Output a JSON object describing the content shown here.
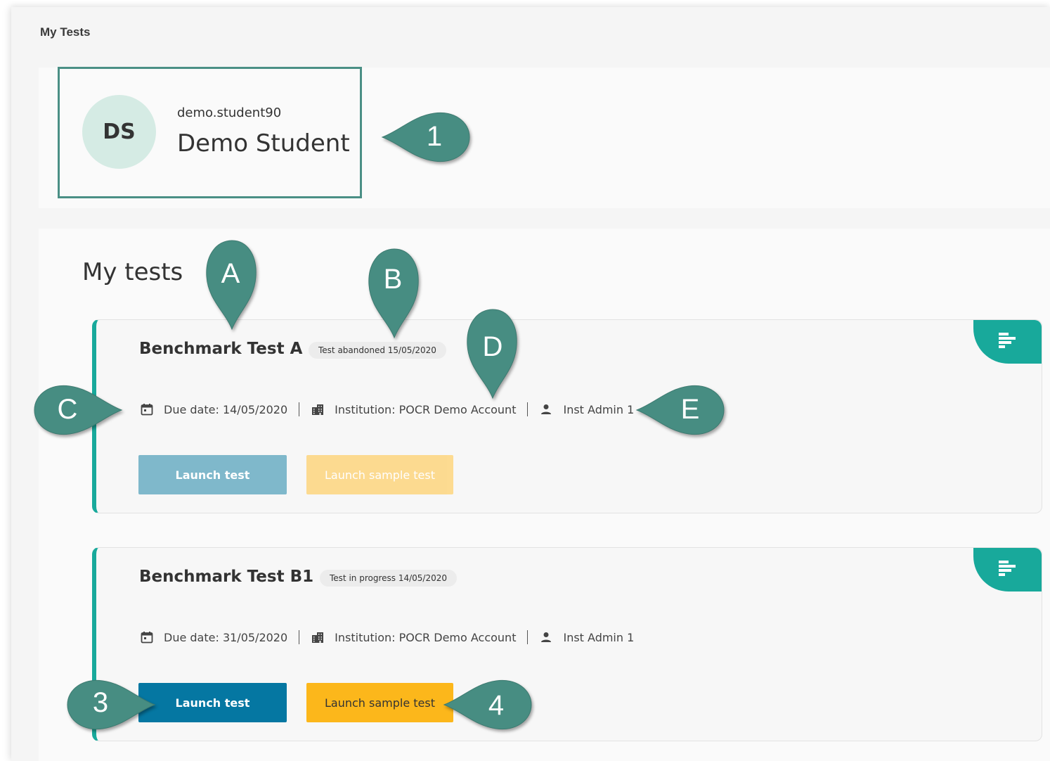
{
  "breadcrumb": "My Tests",
  "profile": {
    "initials": "DS",
    "username": "demo.student90",
    "full_name": "Demo Student"
  },
  "section_title": "My tests",
  "tests": [
    {
      "title": "Benchmark Test A",
      "status": "Test abandoned 15/05/2020",
      "due_date": "Due date: 14/05/2020",
      "institution": "Institution: POCR Demo Account",
      "admin": "Inst Admin 1",
      "launch_label": "Launch test",
      "sample_label": "Launch sample test",
      "state": "disabled"
    },
    {
      "title": "Benchmark Test B1",
      "status": "Test in progress 14/05/2020",
      "due_date": "Due date: 31/05/2020",
      "institution": "Institution: POCR Demo Account",
      "admin": "Inst Admin 1",
      "launch_label": "Launch test",
      "sample_label": "Launch sample test",
      "state": "enabled"
    }
  ],
  "callouts": {
    "one": "1",
    "a": "A",
    "b": "B",
    "c": "C",
    "d": "D",
    "e": "E",
    "three": "3",
    "four": "4"
  },
  "colors": {
    "accent": "#18a99b",
    "callout": "#478d82",
    "launch_active": "#0577a2",
    "sample_active": "#fcb71b"
  },
  "icons": [
    "calendar-icon",
    "building-icon",
    "person-icon",
    "report-icon"
  ]
}
